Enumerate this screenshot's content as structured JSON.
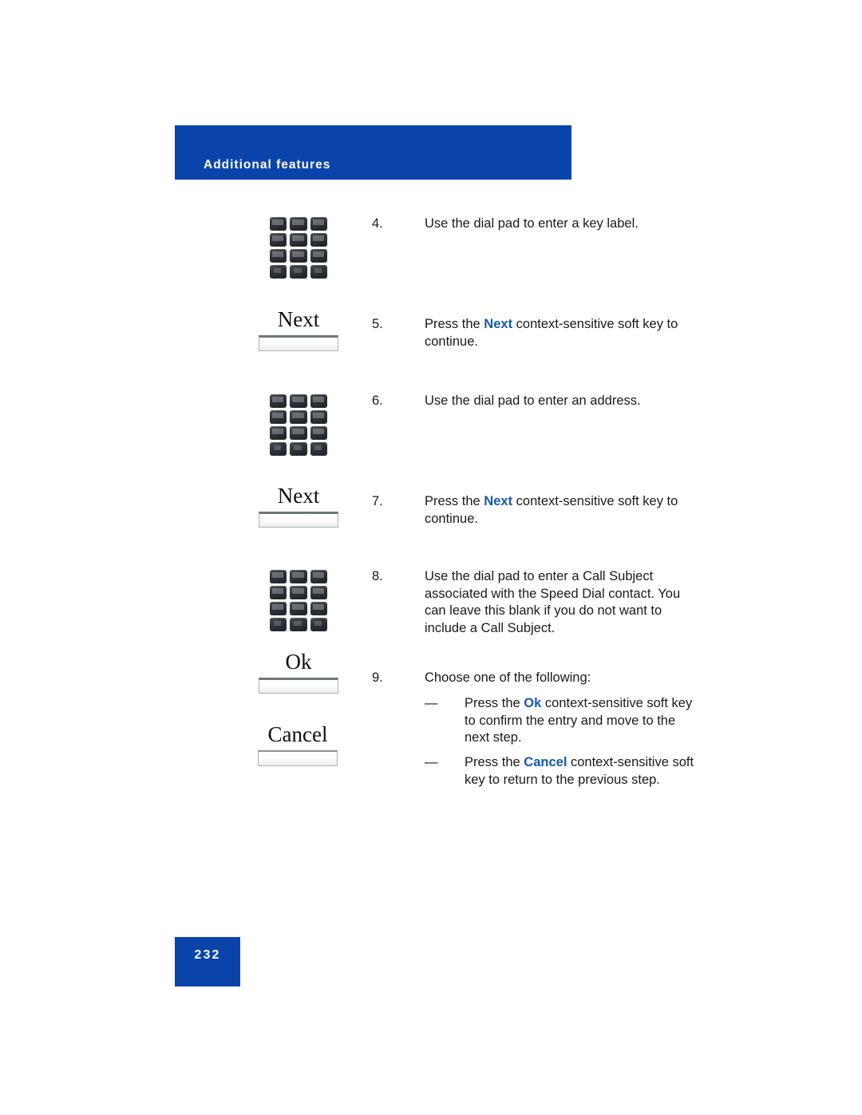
{
  "header": {
    "title": "Additional features",
    "banner_color": "#0a44ab"
  },
  "accent": {
    "highlight_blue": "#1557b5",
    "banner_blue": "#0a44ab"
  },
  "illustrations": [
    {
      "name": "dial-pad",
      "icon": "dial-pad-icon"
    },
    {
      "name": "softkey-next-1",
      "label": "Next"
    },
    {
      "name": "dial-pad",
      "icon": "dial-pad-icon"
    },
    {
      "name": "softkey-next-2",
      "label": "Next"
    },
    {
      "name": "dial-pad",
      "icon": "dial-pad-icon"
    },
    {
      "name": "softkey-ok",
      "label": "Ok"
    },
    {
      "name": "softkey-cancel",
      "label": "Cancel"
    }
  ],
  "softkeys": {
    "next_1": "Next",
    "next_2": "Next",
    "ok": "Ok",
    "cancel": "Cancel"
  },
  "steps": [
    {
      "number": "4.",
      "text_before": "Use the dial pad to enter a key label.",
      "highlight": "",
      "text_after": ""
    },
    {
      "number": "5.",
      "text_before": "Press the ",
      "highlight": "Next",
      "text_after": " context-sensitive soft key to continue."
    },
    {
      "number": "6.",
      "text_before": "Use the dial pad to enter an address.",
      "highlight": "",
      "text_after": ""
    },
    {
      "number": "7.",
      "text_before": "Press the ",
      "highlight": "Next",
      "text_after": " context-sensitive soft key to continue."
    },
    {
      "number": "8.",
      "text_before": "Use the dial pad to enter a Call Subject associated with the Speed Dial contact. You can leave this blank if you do not want to include a Call Subject.",
      "highlight": "",
      "text_after": ""
    },
    {
      "number": "9.",
      "text_before": "Choose one of the following:",
      "highlight": "",
      "text_after": ""
    }
  ],
  "sub_items": [
    {
      "dash": "—",
      "text_before": "Press the ",
      "highlight": "Ok",
      "text_after": " context-sensitive soft key to confirm the entry and move to the next step."
    },
    {
      "dash": "—",
      "text_before": "Press the ",
      "highlight": "Cancel",
      "text_after": " context-sensitive soft key to return to the previous step."
    }
  ],
  "footer": {
    "page_number": "232"
  }
}
